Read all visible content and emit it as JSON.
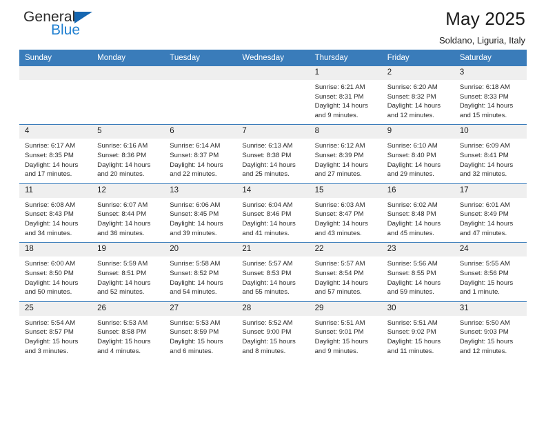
{
  "brand": {
    "name_part1": "General",
    "name_part2": "Blue",
    "flag_icon": "triangle-flag-icon",
    "accent_color": "#1f7fd0"
  },
  "header": {
    "title": "May 2025",
    "subtitle": "Soldano, Liguria, Italy"
  },
  "theme": {
    "header_bar_color": "#3a7cba",
    "daynum_strip_color": "#efefef",
    "text_color": "#1a1a1a"
  },
  "weekday_headers": [
    "Sunday",
    "Monday",
    "Tuesday",
    "Wednesday",
    "Thursday",
    "Friday",
    "Saturday"
  ],
  "weeks": [
    [
      {
        "day": "",
        "sunrise": "",
        "sunset": "",
        "daylight1": "",
        "daylight2": ""
      },
      {
        "day": "",
        "sunrise": "",
        "sunset": "",
        "daylight1": "",
        "daylight2": ""
      },
      {
        "day": "",
        "sunrise": "",
        "sunset": "",
        "daylight1": "",
        "daylight2": ""
      },
      {
        "day": "",
        "sunrise": "",
        "sunset": "",
        "daylight1": "",
        "daylight2": ""
      },
      {
        "day": "1",
        "sunrise": "Sunrise: 6:21 AM",
        "sunset": "Sunset: 8:31 PM",
        "daylight1": "Daylight: 14 hours",
        "daylight2": "and 9 minutes."
      },
      {
        "day": "2",
        "sunrise": "Sunrise: 6:20 AM",
        "sunset": "Sunset: 8:32 PM",
        "daylight1": "Daylight: 14 hours",
        "daylight2": "and 12 minutes."
      },
      {
        "day": "3",
        "sunrise": "Sunrise: 6:18 AM",
        "sunset": "Sunset: 8:33 PM",
        "daylight1": "Daylight: 14 hours",
        "daylight2": "and 15 minutes."
      }
    ],
    [
      {
        "day": "4",
        "sunrise": "Sunrise: 6:17 AM",
        "sunset": "Sunset: 8:35 PM",
        "daylight1": "Daylight: 14 hours",
        "daylight2": "and 17 minutes."
      },
      {
        "day": "5",
        "sunrise": "Sunrise: 6:16 AM",
        "sunset": "Sunset: 8:36 PM",
        "daylight1": "Daylight: 14 hours",
        "daylight2": "and 20 minutes."
      },
      {
        "day": "6",
        "sunrise": "Sunrise: 6:14 AM",
        "sunset": "Sunset: 8:37 PM",
        "daylight1": "Daylight: 14 hours",
        "daylight2": "and 22 minutes."
      },
      {
        "day": "7",
        "sunrise": "Sunrise: 6:13 AM",
        "sunset": "Sunset: 8:38 PM",
        "daylight1": "Daylight: 14 hours",
        "daylight2": "and 25 minutes."
      },
      {
        "day": "8",
        "sunrise": "Sunrise: 6:12 AM",
        "sunset": "Sunset: 8:39 PM",
        "daylight1": "Daylight: 14 hours",
        "daylight2": "and 27 minutes."
      },
      {
        "day": "9",
        "sunrise": "Sunrise: 6:10 AM",
        "sunset": "Sunset: 8:40 PM",
        "daylight1": "Daylight: 14 hours",
        "daylight2": "and 29 minutes."
      },
      {
        "day": "10",
        "sunrise": "Sunrise: 6:09 AM",
        "sunset": "Sunset: 8:41 PM",
        "daylight1": "Daylight: 14 hours",
        "daylight2": "and 32 minutes."
      }
    ],
    [
      {
        "day": "11",
        "sunrise": "Sunrise: 6:08 AM",
        "sunset": "Sunset: 8:43 PM",
        "daylight1": "Daylight: 14 hours",
        "daylight2": "and 34 minutes."
      },
      {
        "day": "12",
        "sunrise": "Sunrise: 6:07 AM",
        "sunset": "Sunset: 8:44 PM",
        "daylight1": "Daylight: 14 hours",
        "daylight2": "and 36 minutes."
      },
      {
        "day": "13",
        "sunrise": "Sunrise: 6:06 AM",
        "sunset": "Sunset: 8:45 PM",
        "daylight1": "Daylight: 14 hours",
        "daylight2": "and 39 minutes."
      },
      {
        "day": "14",
        "sunrise": "Sunrise: 6:04 AM",
        "sunset": "Sunset: 8:46 PM",
        "daylight1": "Daylight: 14 hours",
        "daylight2": "and 41 minutes."
      },
      {
        "day": "15",
        "sunrise": "Sunrise: 6:03 AM",
        "sunset": "Sunset: 8:47 PM",
        "daylight1": "Daylight: 14 hours",
        "daylight2": "and 43 minutes."
      },
      {
        "day": "16",
        "sunrise": "Sunrise: 6:02 AM",
        "sunset": "Sunset: 8:48 PM",
        "daylight1": "Daylight: 14 hours",
        "daylight2": "and 45 minutes."
      },
      {
        "day": "17",
        "sunrise": "Sunrise: 6:01 AM",
        "sunset": "Sunset: 8:49 PM",
        "daylight1": "Daylight: 14 hours",
        "daylight2": "and 47 minutes."
      }
    ],
    [
      {
        "day": "18",
        "sunrise": "Sunrise: 6:00 AM",
        "sunset": "Sunset: 8:50 PM",
        "daylight1": "Daylight: 14 hours",
        "daylight2": "and 50 minutes."
      },
      {
        "day": "19",
        "sunrise": "Sunrise: 5:59 AM",
        "sunset": "Sunset: 8:51 PM",
        "daylight1": "Daylight: 14 hours",
        "daylight2": "and 52 minutes."
      },
      {
        "day": "20",
        "sunrise": "Sunrise: 5:58 AM",
        "sunset": "Sunset: 8:52 PM",
        "daylight1": "Daylight: 14 hours",
        "daylight2": "and 54 minutes."
      },
      {
        "day": "21",
        "sunrise": "Sunrise: 5:57 AM",
        "sunset": "Sunset: 8:53 PM",
        "daylight1": "Daylight: 14 hours",
        "daylight2": "and 55 minutes."
      },
      {
        "day": "22",
        "sunrise": "Sunrise: 5:57 AM",
        "sunset": "Sunset: 8:54 PM",
        "daylight1": "Daylight: 14 hours",
        "daylight2": "and 57 minutes."
      },
      {
        "day": "23",
        "sunrise": "Sunrise: 5:56 AM",
        "sunset": "Sunset: 8:55 PM",
        "daylight1": "Daylight: 14 hours",
        "daylight2": "and 59 minutes."
      },
      {
        "day": "24",
        "sunrise": "Sunrise: 5:55 AM",
        "sunset": "Sunset: 8:56 PM",
        "daylight1": "Daylight: 15 hours",
        "daylight2": "and 1 minute."
      }
    ],
    [
      {
        "day": "25",
        "sunrise": "Sunrise: 5:54 AM",
        "sunset": "Sunset: 8:57 PM",
        "daylight1": "Daylight: 15 hours",
        "daylight2": "and 3 minutes."
      },
      {
        "day": "26",
        "sunrise": "Sunrise: 5:53 AM",
        "sunset": "Sunset: 8:58 PM",
        "daylight1": "Daylight: 15 hours",
        "daylight2": "and 4 minutes."
      },
      {
        "day": "27",
        "sunrise": "Sunrise: 5:53 AM",
        "sunset": "Sunset: 8:59 PM",
        "daylight1": "Daylight: 15 hours",
        "daylight2": "and 6 minutes."
      },
      {
        "day": "28",
        "sunrise": "Sunrise: 5:52 AM",
        "sunset": "Sunset: 9:00 PM",
        "daylight1": "Daylight: 15 hours",
        "daylight2": "and 8 minutes."
      },
      {
        "day": "29",
        "sunrise": "Sunrise: 5:51 AM",
        "sunset": "Sunset: 9:01 PM",
        "daylight1": "Daylight: 15 hours",
        "daylight2": "and 9 minutes."
      },
      {
        "day": "30",
        "sunrise": "Sunrise: 5:51 AM",
        "sunset": "Sunset: 9:02 PM",
        "daylight1": "Daylight: 15 hours",
        "daylight2": "and 11 minutes."
      },
      {
        "day": "31",
        "sunrise": "Sunrise: 5:50 AM",
        "sunset": "Sunset: 9:03 PM",
        "daylight1": "Daylight: 15 hours",
        "daylight2": "and 12 minutes."
      }
    ]
  ]
}
